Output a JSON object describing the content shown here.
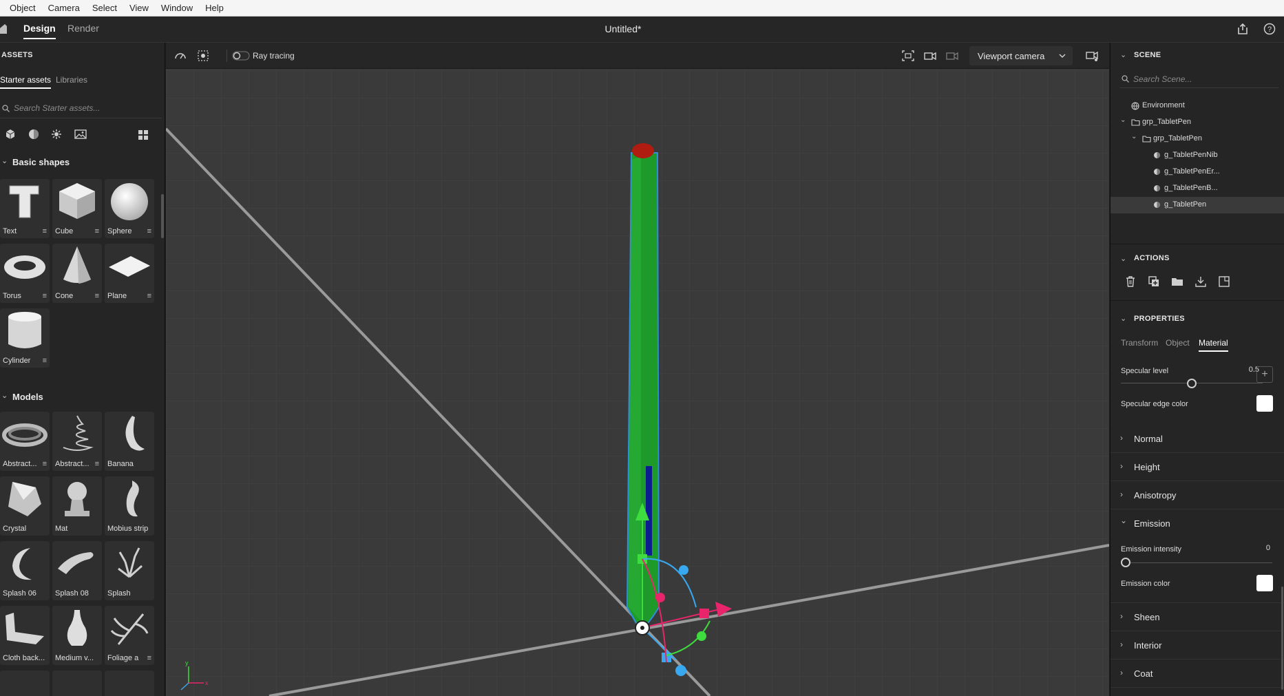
{
  "menu": [
    "Object",
    "Camera",
    "Select",
    "View",
    "Window",
    "Help"
  ],
  "topbar": {
    "tabs": [
      {
        "label": "Design",
        "active": true
      },
      {
        "label": "Render",
        "active": false
      }
    ],
    "document_title": "Untitled*"
  },
  "assets": {
    "title": "ASSETS",
    "tabs": [
      {
        "label": "Starter assets",
        "active": true
      },
      {
        "label": "Libraries",
        "active": false
      }
    ],
    "search_placeholder": "Search Starter assets...",
    "filters": [
      "model-filter-icon",
      "material-filter-icon",
      "light-filter-icon",
      "image-filter-icon",
      "grid-view-icon"
    ],
    "basic_shapes": {
      "label": "Basic shapes",
      "items": [
        "Text",
        "Cube",
        "Sphere",
        "Torus",
        "Cone",
        "Plane",
        "Cylinder"
      ]
    },
    "models": {
      "label": "Models",
      "items": [
        "Abstract...",
        "Abstract...",
        "Banana",
        "Crystal",
        "Mat",
        "Mobius strip",
        "Splash 06",
        "Splash 08",
        "Splash",
        "Cloth back...",
        "Medium v...",
        "Foliage a"
      ]
    }
  },
  "viewport": {
    "ray_tracing_label": "Ray tracing",
    "ray_tracing_on": false,
    "camera": "Viewport camera",
    "axis_labels": {
      "x": "x",
      "y": "y"
    },
    "colors": {
      "pen_body": "#1e9a2a",
      "pen_cap": "#b01c10",
      "selection": "#2f8fdc",
      "gizmo_x": "#e8256b",
      "gizmo_y": "#3fdc3f",
      "gizmo_z": "#38a8f0"
    }
  },
  "scene": {
    "title": "SCENE",
    "search_placeholder": "Search Scene...",
    "items": [
      {
        "label": "Environment",
        "icon": "globe-icon",
        "selected": false
      },
      {
        "label": "grp_TabletPen",
        "icon": "folder-icon",
        "selected": false
      },
      {
        "label": "grp_TabletPen",
        "icon": "folder-icon",
        "selected": false
      },
      {
        "label": "g_TabletPenNib",
        "icon": "mesh-icon",
        "selected": false
      },
      {
        "label": "g_TabletPenEr...",
        "icon": "mesh-icon",
        "selected": false
      },
      {
        "label": "g_TabletPenB...",
        "icon": "mesh-icon",
        "selected": false
      },
      {
        "label": "g_TabletPen",
        "icon": "mesh-icon",
        "selected": true
      }
    ]
  },
  "actions": {
    "title": "ACTIONS",
    "icons": [
      "delete-icon",
      "duplicate-icon",
      "group-icon",
      "download-icon",
      "export-icon"
    ]
  },
  "properties": {
    "title": "PROPERTIES",
    "tabs": [
      {
        "label": "Transform",
        "active": false
      },
      {
        "label": "Object",
        "active": false
      },
      {
        "label": "Material",
        "active": true
      }
    ],
    "specular_level": {
      "label": "Specular level",
      "value": "0.5",
      "fraction": 0.5
    },
    "specular_edge_color": {
      "label": "Specular edge color",
      "color": "#ffffff"
    },
    "sections": [
      "Normal",
      "Height",
      "Anisotropy"
    ],
    "emission": {
      "label": "Emission",
      "intensity": {
        "label": "Emission intensity",
        "value": "0",
        "fraction": 0
      },
      "color": {
        "label": "Emission color",
        "color": "#ffffff"
      }
    },
    "more_sections": [
      "Sheen",
      "Interior",
      "Coat"
    ]
  }
}
